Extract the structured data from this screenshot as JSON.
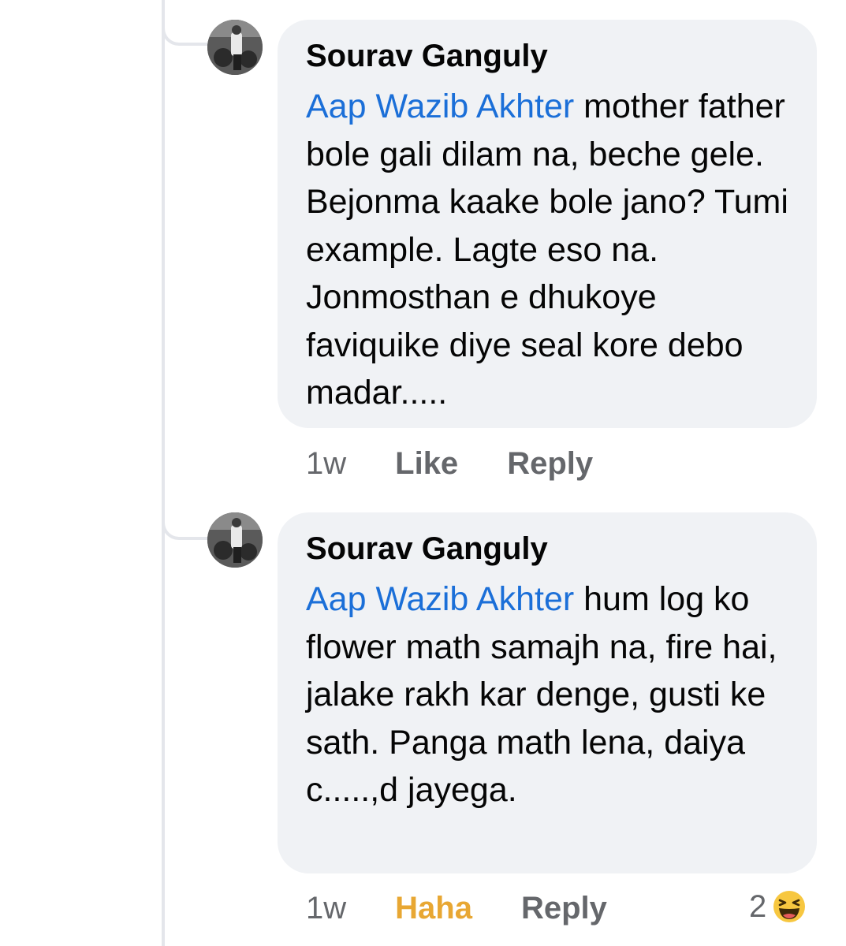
{
  "comments": [
    {
      "author": "Sourav Ganguly",
      "mention": "Aap Wazib Akhter",
      "text": " mother father bole gali dilam na, beche gele. Bejonma kaake bole jano? Tumi example. Lagte eso na. Jonmosthan e dhukoye faviquike diye seal kore debo madar.....",
      "time": "1w",
      "like_label": "Like",
      "reply_label": "Reply"
    },
    {
      "author": "Sourav Ganguly",
      "mention": "Aap Wazib Akhter",
      "text": " hum log ko flower math samajh na, fire hai, jalake rakh kar denge, gusti ke sath. Panga math lena, daiya c.....,d jayega.",
      "time": "1w",
      "reaction_label": "Haha",
      "reply_label": "Reply",
      "reaction_count": "2",
      "reaction_icon": "haha-emoji-icon"
    }
  ],
  "colors": {
    "mention": "#1b6fd8",
    "haha": "#e8a733",
    "bubble": "#f0f2f5",
    "meta": "#65676b"
  }
}
